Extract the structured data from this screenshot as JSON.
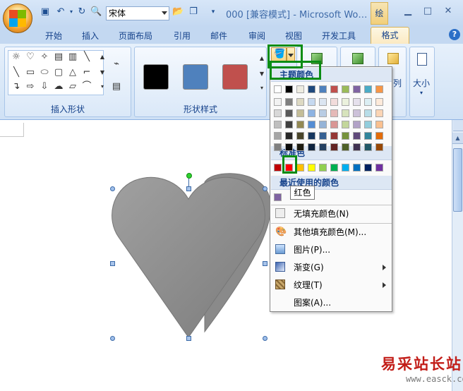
{
  "app": {
    "font_name": "宋体",
    "title": "000 [兼容模式] - Microsoft Wo…",
    "context_tab_top": "绘"
  },
  "tabs": [
    "开始",
    "插入",
    "页面布局",
    "引用",
    "邮件",
    "审阅",
    "视图",
    "开发工具"
  ],
  "active_tab": "格式",
  "ribbon": {
    "insert_shapes_label": "插入形状",
    "shape_styles_label": "形状样式",
    "size_label": "大小",
    "arrange_partial": "列",
    "style_swatch_colors": [
      "#000000",
      "#4f81bd",
      "#c0504d"
    ]
  },
  "fill_menu": {
    "theme_colors_header": "主题颜色",
    "standard_colors_header": "标准色",
    "recent_colors_header": "最近使用的颜色",
    "theme_top_row": [
      "#ffffff",
      "#000000",
      "#eeece1",
      "#1f497d",
      "#4f81bd",
      "#c0504d",
      "#9bbb59",
      "#8064a2",
      "#4bacc6",
      "#f79646"
    ],
    "theme_shades": [
      [
        "#f2f2f2",
        "#7f7f7f",
        "#ddd9c3",
        "#c6d9f0",
        "#dbe5f1",
        "#f2dcdb",
        "#ebf1dd",
        "#e5e0ec",
        "#dbeef3",
        "#fdeada"
      ],
      [
        "#d8d8d8",
        "#595959",
        "#c4bd97",
        "#8db3e2",
        "#b8cce4",
        "#e5b9b7",
        "#d7e3bc",
        "#ccc1d9",
        "#b7dde8",
        "#fbd5b5"
      ],
      [
        "#bfbfbf",
        "#3f3f3f",
        "#938953",
        "#548dd4",
        "#95b3d7",
        "#d99694",
        "#c3d69b",
        "#b2a2c7",
        "#92cddc",
        "#fac08f"
      ],
      [
        "#a5a5a5",
        "#262626",
        "#494429",
        "#17365d",
        "#366092",
        "#953734",
        "#76923c",
        "#5f497a",
        "#31859b",
        "#e36c09"
      ],
      [
        "#7f7f7f",
        "#0c0c0c",
        "#1d1b10",
        "#0f243e",
        "#244061",
        "#632423",
        "#4f6128",
        "#3f3151",
        "#205867",
        "#974806"
      ]
    ],
    "standard_colors": [
      "#c00000",
      "#ff0000",
      "#ffc000",
      "#ffff00",
      "#92d050",
      "#00b050",
      "#00b0f0",
      "#0070c0",
      "#002060",
      "#7030a0"
    ],
    "recent_color": "#8064a2",
    "tooltip": "红色",
    "no_fill": "无填充颜色(N)",
    "more_colors": "其他填充颜色(M)...",
    "picture": "图片(P)...",
    "gradient": "渐变(G)",
    "texture": "纹理(T)",
    "pattern": "图案(A)..."
  },
  "shape": {
    "fill": "#8c8c8c",
    "name": "heart"
  },
  "watermark": {
    "text": "易采站长站",
    "url": "www.easck.com"
  }
}
